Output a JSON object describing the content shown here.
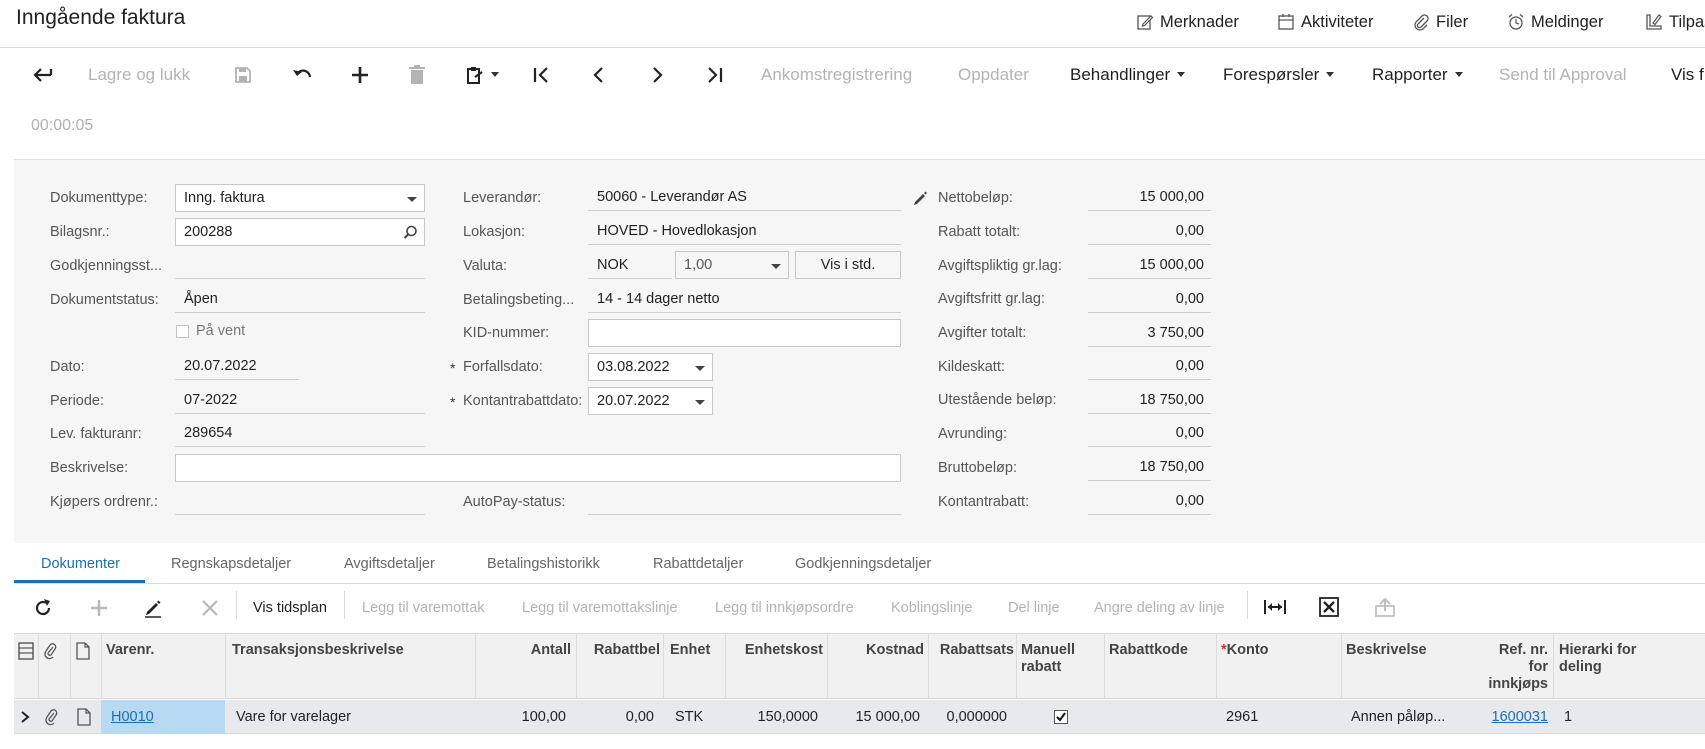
{
  "header": {
    "title": "Inngående faktura",
    "actions": [
      "Merknader",
      "Aktiviteter",
      "Filer",
      "Meldinger",
      "Tilpass"
    ]
  },
  "toolbar": {
    "save_close": "Lagre og lukk",
    "arrival_reg": "Ankomstregistrering",
    "update": "Oppdater",
    "treatments": "Behandlinger",
    "inquiries": "Forespørsler",
    "reports": "Rapporter",
    "send_approval": "Send til Approval",
    "show": "Vis f"
  },
  "timer": "00:00:05",
  "form": {
    "col1": {
      "doc_type_label": "Dokumenttype:",
      "doc_type": "Inng. faktura",
      "voucher_label": "Bilagsnr.:",
      "voucher": "200288",
      "approval_label": "Godkjenningsst...",
      "doc_status_label": "Dokumentstatus:",
      "doc_status": "Åpen",
      "on_hold": "På vent",
      "date_label": "Dato:",
      "date": "20.07.2022",
      "period_label": "Periode:",
      "period": "07-2022",
      "supplier_inv_label": "Lev. fakturanr:",
      "supplier_inv": "289654",
      "description_label": "Beskrivelse:",
      "description": "",
      "buyer_order_label": "Kjøpers ordrenr.:"
    },
    "col2": {
      "supplier_label": "Leverandør:",
      "supplier": "50060 - Leverandør AS",
      "location_label": "Lokasjon:",
      "location": "HOVED - Hovedlokasjon",
      "currency_label": "Valuta:",
      "currency": "NOK",
      "rate": "1,00",
      "show_std": "Vis i std.",
      "terms_label": "Betalingsbeting...",
      "terms": "14 - 14 dager netto",
      "kid_label": "KID-nummer:",
      "kid": "",
      "due_label": "Forfallsdato:",
      "due": "03.08.2022",
      "cash_disc_label": "Kontantrabattdato:",
      "cash_disc": "20.07.2022",
      "autopay_label": "AutoPay-status:",
      "required_mark": "*"
    },
    "col3": [
      {
        "label": "Nettobeløp:",
        "value": "15 000,00"
      },
      {
        "label": "Rabatt totalt:",
        "value": "0,00"
      },
      {
        "label": "Avgiftspliktig gr.lag:",
        "value": "15 000,00"
      },
      {
        "label": "Avgiftsfritt gr.lag:",
        "value": "0,00"
      },
      {
        "label": "Avgifter totalt:",
        "value": "3 750,00"
      },
      {
        "label": "Kildeskatt:",
        "value": "0,00"
      },
      {
        "label": "Utestående beløp:",
        "value": "18 750,00"
      },
      {
        "label": "Avrunding:",
        "value": "0,00"
      },
      {
        "label": "Bruttobeløp:",
        "value": "18 750,00"
      },
      {
        "label": "Kontantrabatt:",
        "value": "0,00"
      }
    ]
  },
  "tabs": [
    "Dokumenter",
    "Regnskapsdetaljer",
    "Avgiftsdetaljer",
    "Betalingshistorikk",
    "Rabattdetaljer",
    "Godkjenningsdetaljer"
  ],
  "grid_toolbar": {
    "schedule": "Vis tidsplan",
    "add_receipt": "Legg til varemottak",
    "add_receipt_line": "Legg til varemottakslinje",
    "add_po": "Legg til innkjøpsordre",
    "link_line": "Koblingslinje",
    "split_line": "Del linje",
    "undo_split": "Angre deling av linje"
  },
  "grid": {
    "headers": {
      "item": "Varenr.",
      "trans_desc": "Transaksjonsbeskrivelse",
      "qty": "Antall",
      "disc_pct": "Rabattbel",
      "uom": "Enhet",
      "unit_cost": "Enhetskost",
      "cost": "Kostnad",
      "disc_rate": "Rabattsats",
      "manual_disc_1": "Manuell",
      "manual_disc_2": "rabatt",
      "disc_code": "Rabattkode",
      "account": "Konto",
      "description": "Beskrivelse",
      "ref_1": "Ref. nr.",
      "ref_2": "for",
      "ref_3": "innkjøps",
      "hier_1": "Hierarki for",
      "hier_2": "deling",
      "required_mark": "*"
    },
    "row": {
      "item": "H0010",
      "trans_desc": "Vare for varelager",
      "qty": "100,00",
      "disc_amt": "0,00",
      "uom": "STK",
      "unit_cost": "150,0000",
      "cost": "15 000,00",
      "disc_rate": "0,000000",
      "manual_disc": true,
      "disc_code": "",
      "account": "2961",
      "description": "Annen påløp...",
      "ref": "1600031",
      "hierarchy": "1"
    }
  }
}
